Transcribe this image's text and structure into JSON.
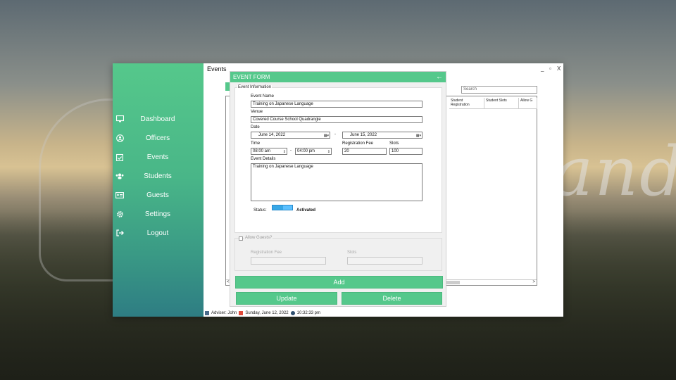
{
  "watermark": "helping hand",
  "sidebar": {
    "items": [
      {
        "label": "Dashboard",
        "icon": "monitor-icon"
      },
      {
        "label": "Officers",
        "icon": "user-circle-icon"
      },
      {
        "label": "Events",
        "icon": "calendar-check-icon"
      },
      {
        "label": "Students",
        "icon": "users-icon"
      },
      {
        "label": "Guests",
        "icon": "id-card-icon"
      },
      {
        "label": "Settings",
        "icon": "gear-icon"
      },
      {
        "label": "Logout",
        "icon": "logout-icon"
      }
    ]
  },
  "main": {
    "title": "Events",
    "window_controls": {
      "minimize": "_",
      "maximize": "▫",
      "close": "X"
    },
    "search_placeholder": "Search",
    "grid_headers": [
      "Student Registration",
      "Student Slots",
      "Allow G"
    ],
    "grid_scroll_left": "<",
    "grid_scroll_right": ">"
  },
  "statusbar": {
    "adviser": "Adviser: John",
    "date": "Sunday, June 12, 2022",
    "time": "10:32:33 pm"
  },
  "event_form": {
    "title": "EVENT FORM",
    "back_icon": "←",
    "event_info_legend": "Event Information",
    "event_name_label": "Event Name",
    "event_name_value": "Training on Japanese Language",
    "venue_label": "Venue",
    "venue_value": "Covered Course School Quadrangle",
    "date_label": "Date",
    "date_start": "June     14, 2022",
    "date_end": "June     15, 2022",
    "date_separator": "-",
    "time_label": "Time",
    "time_start": "08:00 am",
    "time_end": "04:00 pm",
    "time_separator": "-",
    "reg_fee_label": "Registration Fee",
    "reg_fee_value": "20",
    "slots_label": "Slots",
    "slots_value": "100",
    "event_details_label": "Event Details",
    "event_details_value": "Training on Japanese Language",
    "status_label": "Status:",
    "status_value": "Activated",
    "allow_guests_label": "Allow Guests?",
    "guest_reg_fee_label": "Registration Fee",
    "guest_slots_label": "Slots",
    "add_button": "Add",
    "update_button": "Update",
    "delete_button": "Delete"
  },
  "colors": {
    "accent": "#55c88b",
    "sidebar_bottom": "#2e7d83",
    "toggle": "#37a7e6"
  }
}
